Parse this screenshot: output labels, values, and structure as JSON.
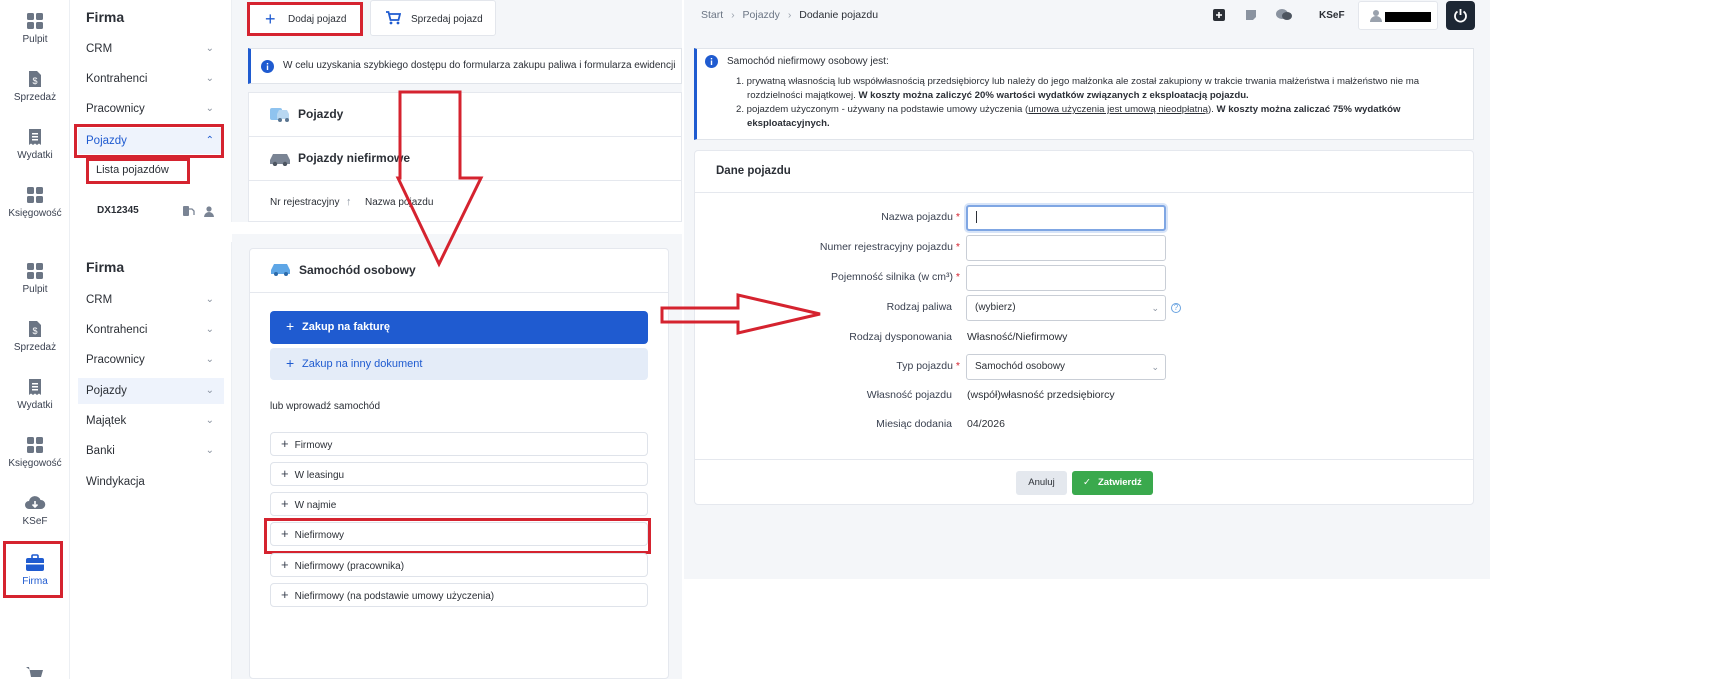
{
  "rail_top": [
    {
      "label": "Pulpit",
      "icon": "grid-icon"
    },
    {
      "label": "Sprzedaż",
      "icon": "invoice-icon"
    },
    {
      "label": "Wydatki",
      "icon": "receipt-icon"
    },
    {
      "label": "Księgowość",
      "icon": "grid-icon"
    }
  ],
  "rail_bottom": [
    {
      "label": "Pulpit",
      "icon": "grid-icon"
    },
    {
      "label": "Sprzedaż",
      "icon": "invoice-icon"
    },
    {
      "label": "Wydatki",
      "icon": "receipt-icon"
    },
    {
      "label": "Księgowość",
      "icon": "grid-icon"
    },
    {
      "label": "KSeF",
      "icon": "cloud-download-icon"
    },
    {
      "label": "Firma",
      "icon": "briefcase-icon"
    }
  ],
  "menu_top": {
    "title": "Firma",
    "items": [
      "CRM",
      "Kontrahenci",
      "Pracownicy",
      "Pojazdy"
    ],
    "subitem": "Lista pojazdów",
    "vehicle": "DX12345"
  },
  "menu_bottom": {
    "title": "Firma",
    "items": [
      "CRM",
      "Kontrahenci",
      "Pracownicy",
      "Pojazdy",
      "Majątek",
      "Banki",
      "Windykacja"
    ]
  },
  "toolbar": {
    "add_vehicle": "Dodaj pojazd",
    "sell_vehicle": "Sprzedaj pojazd"
  },
  "info_banner": "W celu uzyskania szybkiego dostępu do formularza zakupu paliwa i formularza ewidencji",
  "vehicles_panel": {
    "title": "Pojazdy",
    "non_company_title": "Pojazdy niefirmowe",
    "col_reg": "Nr rejestracyjny",
    "col_name": "Nazwa pojazdu"
  },
  "car_panel": {
    "title": "Samochód osobowy",
    "btn_invoice": "Zakup na fakturę",
    "btn_other": "Zakup na inny dokument",
    "or_enter": "lub wprowadź samochód",
    "options": [
      "Firmowy",
      "W leasingu",
      "W najmie",
      "Niefirmowy",
      "Niefirmowy (pracownika)",
      "Niefirmowy (na podstawie umowy użyczenia)"
    ]
  },
  "breadcrumb": {
    "start": "Start",
    "vehicles": "Pojazdy",
    "current": "Dodanie pojazdu"
  },
  "header": {
    "ksef": "KSeF"
  },
  "notice": {
    "intro": "Samochód niefirmowy osobowy jest:",
    "item1_a": "prywatną własnością lub współwłasnością przedsiębiorcy lub należy do jego małżonka ale został zakupiony w trakcie trwania małżeństwa i małżeństwo nie ma",
    "item1_b": "rozdzielności majątkowej.",
    "item1_bold": "W koszty można zaliczyć 20% wartości wydatków związanych z eksploatacją pojazdu.",
    "item2_a": "pojazdem użyczonym - używany na podstawie umowy użyczenia (",
    "item2_link": "umowa użyczenia jest umową nieodpłatną",
    "item2_b": ").",
    "item2_bold1": "W koszty można zaliczać 75% wydatków",
    "item2_bold2": "eksploatacyjnych."
  },
  "form": {
    "title": "Dane pojazdu",
    "name_label": "Nazwa pojazdu",
    "reg_label": "Numer rejestracyjny pojazdu",
    "engine_label": "Pojemność silnika (w cm³)",
    "fuel_label": "Rodzaj paliwa",
    "fuel_value": "(wybierz)",
    "disposal_label": "Rodzaj dysponowania",
    "disposal_value": "Własność/Niefirmowy",
    "type_label": "Typ pojazdu",
    "type_value": "Samochód osobowy",
    "ownership_label": "Własność pojazdu",
    "ownership_value": "(współ)własność przedsiębiorcy",
    "month_label": "Miesiąc dodania",
    "month_value": "04/2026",
    "cancel": "Anuluj",
    "confirm": "Zatwierdź"
  },
  "colors": {
    "accent_blue": "#1f5bd0",
    "highlight_red": "#d5232f",
    "confirm_green": "#3aa94d"
  }
}
